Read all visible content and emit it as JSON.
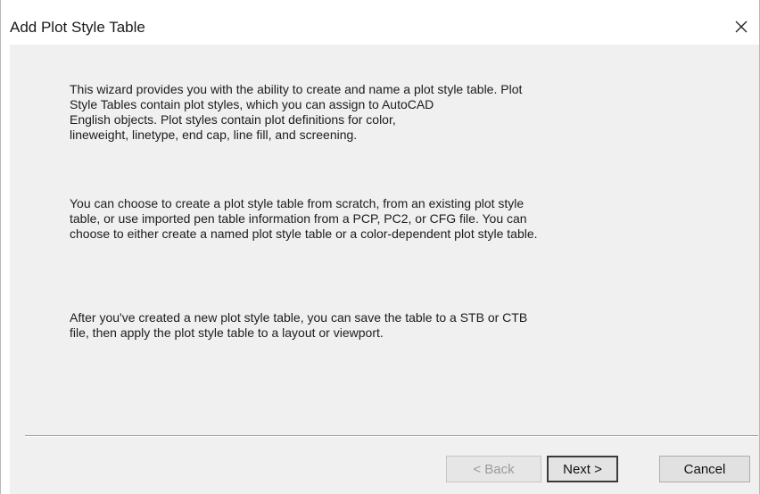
{
  "window": {
    "title": "Add Plot Style Table",
    "close_glyph": "close-icon"
  },
  "content": {
    "paragraph1": [
      "This wizard provides you with the ability to create and name a plot style table. Plot",
      "Style Tables contain plot styles, which you can assign to AutoCAD",
      "English objects. Plot styles contain plot definitions for color,",
      "lineweight, linetype, end cap, line fill, and screening."
    ],
    "paragraph2": [
      "You can choose to create a plot style table from scratch, from an existing plot style",
      "table, or use imported pen table information from a PCP, PC2, or CFG file. You can",
      "choose to either create a named plot style table or a color-dependent plot style table."
    ],
    "paragraph3": [
      "After you've created a new plot style table, you can save the table to a STB or CTB",
      "file, then apply the plot style table to a layout or viewport."
    ]
  },
  "buttons": {
    "back_label": "< Back",
    "back_enabled": false,
    "next_label": "Next >",
    "next_default": true,
    "cancel_label": "Cancel"
  },
  "colors": {
    "content_background": "#f0f0f0",
    "title_background": "#ffffff",
    "disabled_text": "#9a9a9a",
    "text": "#1c1c1c"
  }
}
